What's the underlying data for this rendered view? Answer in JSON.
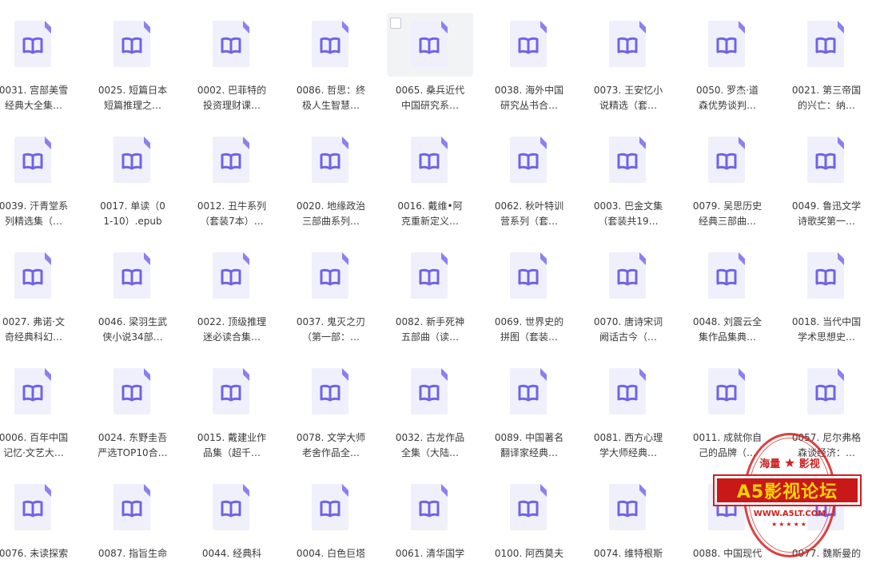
{
  "files": [
    {
      "line1": "0031. 宫部美雪",
      "line2": "经典大全集…"
    },
    {
      "line1": "0025. 短篇日本",
      "line2": "短篇推理之…"
    },
    {
      "line1": "0002. 巴菲特的",
      "line2": "投资理财课…"
    },
    {
      "line1": "0086. 哲思：终",
      "line2": "极人生智慧…"
    },
    {
      "line1": "0065. 桑兵近代",
      "line2": "中国研究系…"
    },
    {
      "line1": "0038. 海外中国",
      "line2": "研究丛书合…"
    },
    {
      "line1": "0073. 王安忆小",
      "line2": "说精选（套…"
    },
    {
      "line1": "0050. 罗杰·道",
      "line2": "森优势谈判…"
    },
    {
      "line1": "0021. 第三帝国",
      "line2": "的兴亡：纳…"
    },
    {
      "line1": "0039. 汗青堂系",
      "line2": "列精选集（…"
    },
    {
      "line1": "0017. 单读（0",
      "line2": "1-10）.epub"
    },
    {
      "line1": "0012. 丑牛系列",
      "line2": "（套装7本）…"
    },
    {
      "line1": "0020. 地缘政治",
      "line2": "三部曲系列…"
    },
    {
      "line1": "0016. 戴维•阿",
      "line2": "克重新定义…"
    },
    {
      "line1": "0062. 秋叶特训",
      "line2": "营系列（套…"
    },
    {
      "line1": "0003. 巴金文集",
      "line2": "（套装共19…"
    },
    {
      "line1": "0079. 吴思历史",
      "line2": "经典三部曲…"
    },
    {
      "line1": "0049. 鲁迅文学",
      "line2": "诗歌奖第一…"
    },
    {
      "line1": "0027. 弗诺·文",
      "line2": "奇经典科幻…"
    },
    {
      "line1": "0046. 梁羽生武",
      "line2": "侠小说34部…"
    },
    {
      "line1": "0022. 顶级推理",
      "line2": "迷必读合集…"
    },
    {
      "line1": "0037. 鬼灭之刃",
      "line2": "（第一部：…"
    },
    {
      "line1": "0082. 新手死神",
      "line2": "五部曲（读…"
    },
    {
      "line1": "0069. 世界史的",
      "line2": "拼图（套装…"
    },
    {
      "line1": "0070. 唐诗宋词",
      "line2": "阙话古今（…"
    },
    {
      "line1": "0048. 刘震云全",
      "line2": "集作品集典…"
    },
    {
      "line1": "0018. 当代中国",
      "line2": "学术思想史…"
    },
    {
      "line1": "0006. 百年中国",
      "line2": "记忆·文艺大…"
    },
    {
      "line1": "0024. 东野圭吾",
      "line2": "严选TOP10合…"
    },
    {
      "line1": "0015. 戴建业作",
      "line2": "品集（超千…"
    },
    {
      "line1": "0078. 文学大师",
      "line2": "老舍作品全…"
    },
    {
      "line1": "0032. 古龙作品",
      "line2": "全集（大陆…"
    },
    {
      "line1": "0089. 中国著名",
      "line2": "翻译家经典…"
    },
    {
      "line1": "0081. 西方心理",
      "line2": "学大师经典…"
    },
    {
      "line1": "0011. 成就你自",
      "line2": "己的品牌（…"
    },
    {
      "line1": "0057. 尼尔弗格",
      "line2": "森谈经济：…"
    },
    {
      "line1": "0076. 未读探索",
      "line2": ""
    },
    {
      "line1": "0087. 指旨生命",
      "line2": ""
    },
    {
      "line1": "0044. 经典科",
      "line2": ""
    },
    {
      "line1": "0004. 白色巨塔",
      "line2": ""
    },
    {
      "line1": "0061. 清华国学",
      "line2": ""
    },
    {
      "line1": "0100. 阿西莫夫",
      "line2": ""
    },
    {
      "line1": "0074. 维特根斯",
      "line2": ""
    },
    {
      "line1": "0088. 中国现代",
      "line2": ""
    },
    {
      "line1": "0077. 魏斯曼的",
      "line2": ""
    }
  ],
  "hovered_index": 4,
  "colors": {
    "doc_bg": "#f0f0fc",
    "doc_fold": "#8b80f0",
    "book_stroke": "#6f63e6",
    "text": "#3a3a3a"
  },
  "watermark": {
    "top": "海量",
    "top_right": "影视",
    "banner": "A5影视论坛",
    "url": "WWW.A5LT.COM"
  }
}
